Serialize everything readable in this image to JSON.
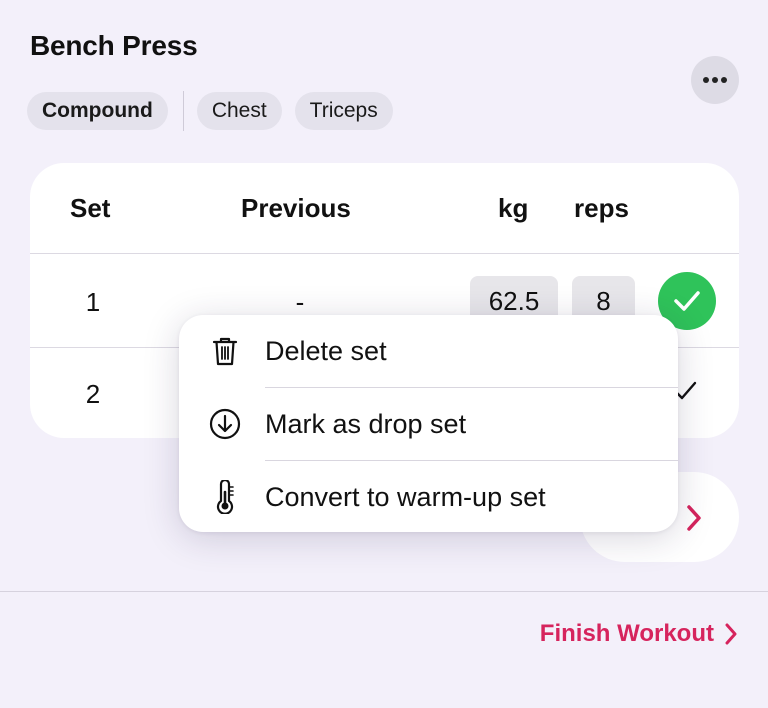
{
  "exercise": {
    "title": "Bench Press",
    "tags": [
      "Compound",
      "Chest",
      "Triceps"
    ],
    "more_icon": "ellipsis-icon"
  },
  "table": {
    "headers": {
      "set": "Set",
      "previous": "Previous",
      "kg": "kg",
      "reps": "reps"
    },
    "rows": [
      {
        "set": "1",
        "previous": "-",
        "kg": "62.5",
        "reps": "8",
        "completed": true
      },
      {
        "set": "2",
        "previous": "",
        "kg": "",
        "reps": "",
        "completed": false
      }
    ]
  },
  "context_menu": {
    "items": [
      {
        "label": "Delete set",
        "icon": "trash-icon"
      },
      {
        "label": "Mark as drop set",
        "icon": "arrow-down-circle-icon"
      },
      {
        "label": "Convert to warm-up set",
        "icon": "thermometer-icon"
      }
    ]
  },
  "footer": {
    "finish_label": "Finish Workout"
  },
  "colors": {
    "background": "#f3f0fa",
    "accent": "#d6245d",
    "success": "#2fc35a",
    "card": "#ffffff"
  }
}
